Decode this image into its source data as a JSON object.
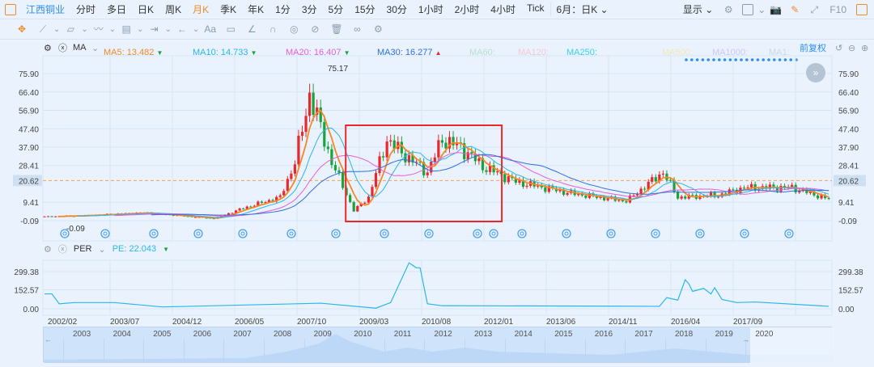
{
  "toolbar": {
    "stock": "江西铜业",
    "periods": [
      "分时",
      "多日",
      "日K",
      "周K",
      "月K",
      "季K",
      "年K",
      "1分",
      "3分",
      "5分",
      "15分",
      "30分",
      "1小时",
      "2小时",
      "4小时",
      "Tick"
    ],
    "active_period": "月K",
    "dropdown": "6月：日K",
    "display": "显示",
    "f10": "F10"
  },
  "drawing_tools": [
    "move-icon",
    "line-icon",
    "channel-icon",
    "wave-icon",
    "fib-icon",
    "range-icon",
    "arrow-icon",
    "text-icon",
    "comment-icon",
    "angle-icon",
    "magnet-icon",
    "lock-icon",
    "hide-icon",
    "trash-icon",
    "link-icon",
    "settings-icon"
  ],
  "drawing_text_tool": "Aa",
  "ma_legend": {
    "name": "MA",
    "items": [
      {
        "label": "MA5: 13.482",
        "color": "#f5872b",
        "trend": "down"
      },
      {
        "label": "MA10: 14.733",
        "color": "#2bb5e8",
        "trend": "down"
      },
      {
        "label": "MA20: 16.407",
        "color": "#e45ed8",
        "trend": "down"
      },
      {
        "label": "MA30: 16.277",
        "color": "#2f6fe0",
        "trend": "up"
      },
      {
        "label": "MA60:",
        "color": "#b8e0d0"
      },
      {
        "label": "MA120:",
        "color": "#f4c8d4"
      },
      {
        "label": "MA250:",
        "color": "#38d0e8"
      },
      {
        "label": "MA500:",
        "color": "#f2e6b6"
      },
      {
        "label": "MA1000:",
        "color": "#cfc4f4"
      },
      {
        "label": "MA1:",
        "color": "#d0d6dc"
      }
    ],
    "adjust": "前复权"
  },
  "per_legend": {
    "name": "PER",
    "value": "PE: 22.043",
    "trend": "down"
  },
  "colors": {
    "up": "#e8282b",
    "down": "#1aa33a",
    "accent": "#2d8cf0",
    "highlight_box": "#e8282b",
    "pe_line": "#29b6ea",
    "current_price_line": "#f5a04a"
  },
  "chart_data": [
    {
      "type": "candlestick",
      "title": "",
      "y_ticks": [
        "75.90",
        "66.40",
        "56.90",
        "47.40",
        "37.90",
        "28.41",
        "20.62",
        "9.41",
        "-0.09"
      ],
      "ylim": [
        -0.09,
        75.9
      ],
      "current_price": "20.62",
      "max_label": "75.17",
      "min_label": "-0.09",
      "close_keypoints": [
        [
          "2002/02",
          2.0
        ],
        [
          "2002/12",
          2.5
        ],
        [
          "2004/05",
          4.0
        ],
        [
          "2005/12",
          1.0
        ],
        [
          "2006/09",
          7.0
        ],
        [
          "2007/06",
          12.0
        ],
        [
          "2007/10",
          30.0
        ],
        [
          "2008/02",
          65.0
        ],
        [
          "2008/05",
          48.0
        ],
        [
          "2008/08",
          30.0
        ],
        [
          "2008/11",
          18.0
        ],
        [
          "2009/02",
          5.0
        ],
        [
          "2009/06",
          12.0
        ],
        [
          "2009/11",
          42.0
        ],
        [
          "2010/03",
          35.0
        ],
        [
          "2010/10",
          25.0
        ],
        [
          "2011/02",
          42.0
        ],
        [
          "2011/07",
          38.0
        ],
        [
          "2012/01",
          28.0
        ],
        [
          "2012/10",
          20.0
        ],
        [
          "2014/01",
          14.0
        ],
        [
          "2015/04",
          10.0
        ],
        [
          "2016/02",
          25.0
        ],
        [
          "2016/06",
          12.0
        ],
        [
          "2017/05",
          13.0
        ],
        [
          "2017/12",
          17.0
        ],
        [
          "2019/01",
          17.0
        ],
        [
          "2019/11",
          11.0
        ]
      ],
      "highlight_range": [
        "2009/02",
        "2012/04"
      ]
    },
    {
      "type": "line",
      "series_name": "PE",
      "y_ticks": [
        "299.38",
        "152.57",
        "0.00"
      ],
      "keypoints": [
        [
          "2002/02",
          120
        ],
        [
          "2002/04",
          120
        ],
        [
          "2002/06",
          40
        ],
        [
          "2002/10",
          50
        ],
        [
          "2003/09",
          50
        ],
        [
          "2004/10",
          15
        ],
        [
          "2008/05",
          45
        ],
        [
          "2009/08",
          5
        ],
        [
          "2009/12",
          50
        ],
        [
          "2010/05",
          370
        ],
        [
          "2010/07",
          330
        ],
        [
          "2010/08",
          330
        ],
        [
          "2010/10",
          40
        ],
        [
          "2011/02",
          25
        ],
        [
          "2016/01",
          20
        ],
        [
          "2016/03",
          90
        ],
        [
          "2016/06",
          70
        ],
        [
          "2016/08",
          234
        ],
        [
          "2016/09",
          200
        ],
        [
          "2016/10",
          140
        ],
        [
          "2017/01",
          165
        ],
        [
          "2017/03",
          120
        ],
        [
          "2017/04",
          170
        ],
        [
          "2017/06",
          75
        ],
        [
          "2017/10",
          50
        ],
        [
          "2018/03",
          55
        ],
        [
          "2019/11",
          20
        ]
      ]
    }
  ],
  "date_axis": [
    "2002/02",
    "2003/07",
    "2004/12",
    "2006/05",
    "2007/10",
    "2009/03",
    "2010/08",
    "2012/01",
    "2013/06",
    "2014/11",
    "2016/04",
    "2017/09"
  ],
  "navigator_years": [
    "2003",
    "2004",
    "2005",
    "2006",
    "2007",
    "2008",
    "2009",
    "2010",
    "2011",
    "2012",
    "2013",
    "2014",
    "2015",
    "2016",
    "2017",
    "2018",
    "2019",
    "2020"
  ]
}
